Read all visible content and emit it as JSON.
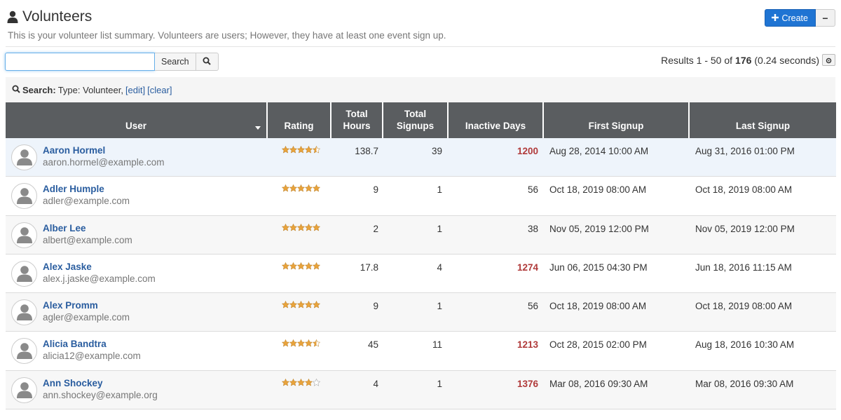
{
  "header": {
    "title": "Volunteers",
    "subtitle": "This is your volunteer list summary. Volunteers are users; However, they have at least one event sign up.",
    "create_label": "Create",
    "minus_label": "−"
  },
  "search": {
    "value": "",
    "placeholder": "",
    "button_label": "Search"
  },
  "results": {
    "prefix": "Results 1 - 50 of",
    "total": "176",
    "suffix": "(0.24 seconds)"
  },
  "filter": {
    "label": "Search:",
    "text": "Type: Volunteer,",
    "edit_label": "[edit]",
    "clear_label": "[clear]"
  },
  "columns": {
    "user": "User",
    "rating": "Rating",
    "hours": "Total Hours",
    "signups": "Total Signups",
    "inactive": "Inactive Days",
    "first": "First Signup",
    "last": "Last Signup"
  },
  "colors": {
    "accent": "#1f74d3",
    "link": "#2a5d9f",
    "header_bg": "#5a5d60",
    "alert_red": "#b03a3a",
    "star": "#e8a33c"
  },
  "rows": [
    {
      "name": "Aaron Hormel",
      "email": "aaron.hormel@example.com",
      "rating": 4.5,
      "hours": "138.7",
      "signups": "39",
      "inactive": "1200",
      "inactive_alert": true,
      "first": "Aug 28, 2014 10:00 AM",
      "last": "Aug 31, 2016 01:00 PM"
    },
    {
      "name": "Adler Humple",
      "email": "adler@example.com",
      "rating": 5,
      "hours": "9",
      "signups": "1",
      "inactive": "56",
      "inactive_alert": false,
      "first": "Oct 18, 2019 08:00 AM",
      "last": "Oct 18, 2019 08:00 AM"
    },
    {
      "name": "Alber Lee",
      "email": "albert@example.com",
      "rating": 5,
      "hours": "2",
      "signups": "1",
      "inactive": "38",
      "inactive_alert": false,
      "first": "Nov 05, 2019 12:00 PM",
      "last": "Nov 05, 2019 12:00 PM"
    },
    {
      "name": "Alex Jaske",
      "email": "alex.j.jaske@example.com",
      "rating": 5,
      "hours": "17.8",
      "signups": "4",
      "inactive": "1274",
      "inactive_alert": true,
      "first": "Jun 06, 2015 04:30 PM",
      "last": "Jun 18, 2016 11:15 AM"
    },
    {
      "name": "Alex Promm",
      "email": "agler@example.com",
      "rating": 5,
      "hours": "9",
      "signups": "1",
      "inactive": "56",
      "inactive_alert": false,
      "first": "Oct 18, 2019 08:00 AM",
      "last": "Oct 18, 2019 08:00 AM"
    },
    {
      "name": "Alicia Bandtra",
      "email": "alicia12@example.com",
      "rating": 4.5,
      "hours": "45",
      "signups": "11",
      "inactive": "1213",
      "inactive_alert": true,
      "first": "Oct 28, 2015 02:00 PM",
      "last": "Aug 18, 2016 10:30 AM"
    },
    {
      "name": "Ann Shockey",
      "email": "ann.shockey@example.org",
      "rating": 4,
      "hours": "4",
      "signups": "1",
      "inactive": "1376",
      "inactive_alert": true,
      "first": "Mar 08, 2016 09:30 AM",
      "last": "Mar 08, 2016 09:30 AM"
    }
  ]
}
